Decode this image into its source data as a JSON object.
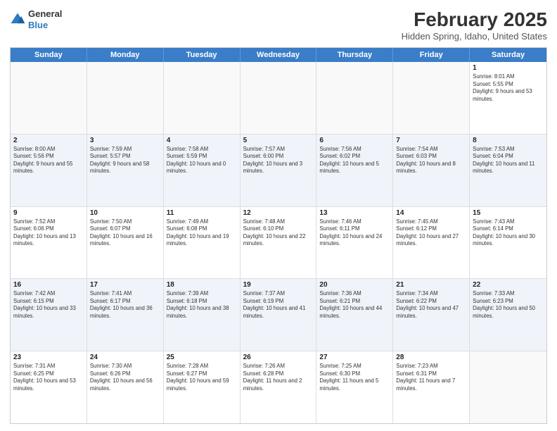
{
  "header": {
    "logo": {
      "general": "General",
      "blue": "Blue"
    },
    "title": "February 2025",
    "location": "Hidden Spring, Idaho, United States"
  },
  "calendar": {
    "days": [
      "Sunday",
      "Monday",
      "Tuesday",
      "Wednesday",
      "Thursday",
      "Friday",
      "Saturday"
    ],
    "rows": [
      [
        {
          "day": "",
          "text": ""
        },
        {
          "day": "",
          "text": ""
        },
        {
          "day": "",
          "text": ""
        },
        {
          "day": "",
          "text": ""
        },
        {
          "day": "",
          "text": ""
        },
        {
          "day": "",
          "text": ""
        },
        {
          "day": "1",
          "text": "Sunrise: 8:01 AM\nSunset: 5:55 PM\nDaylight: 9 hours and 53 minutes."
        }
      ],
      [
        {
          "day": "2",
          "text": "Sunrise: 8:00 AM\nSunset: 5:56 PM\nDaylight: 9 hours and 55 minutes."
        },
        {
          "day": "3",
          "text": "Sunrise: 7:59 AM\nSunset: 5:57 PM\nDaylight: 9 hours and 58 minutes."
        },
        {
          "day": "4",
          "text": "Sunrise: 7:58 AM\nSunset: 5:59 PM\nDaylight: 10 hours and 0 minutes."
        },
        {
          "day": "5",
          "text": "Sunrise: 7:57 AM\nSunset: 6:00 PM\nDaylight: 10 hours and 3 minutes."
        },
        {
          "day": "6",
          "text": "Sunrise: 7:56 AM\nSunset: 6:02 PM\nDaylight: 10 hours and 5 minutes."
        },
        {
          "day": "7",
          "text": "Sunrise: 7:54 AM\nSunset: 6:03 PM\nDaylight: 10 hours and 8 minutes."
        },
        {
          "day": "8",
          "text": "Sunrise: 7:53 AM\nSunset: 6:04 PM\nDaylight: 10 hours and 11 minutes."
        }
      ],
      [
        {
          "day": "9",
          "text": "Sunrise: 7:52 AM\nSunset: 6:06 PM\nDaylight: 10 hours and 13 minutes."
        },
        {
          "day": "10",
          "text": "Sunrise: 7:50 AM\nSunset: 6:07 PM\nDaylight: 10 hours and 16 minutes."
        },
        {
          "day": "11",
          "text": "Sunrise: 7:49 AM\nSunset: 6:08 PM\nDaylight: 10 hours and 19 minutes."
        },
        {
          "day": "12",
          "text": "Sunrise: 7:48 AM\nSunset: 6:10 PM\nDaylight: 10 hours and 22 minutes."
        },
        {
          "day": "13",
          "text": "Sunrise: 7:46 AM\nSunset: 6:11 PM\nDaylight: 10 hours and 24 minutes."
        },
        {
          "day": "14",
          "text": "Sunrise: 7:45 AM\nSunset: 6:12 PM\nDaylight: 10 hours and 27 minutes."
        },
        {
          "day": "15",
          "text": "Sunrise: 7:43 AM\nSunset: 6:14 PM\nDaylight: 10 hours and 30 minutes."
        }
      ],
      [
        {
          "day": "16",
          "text": "Sunrise: 7:42 AM\nSunset: 6:15 PM\nDaylight: 10 hours and 33 minutes."
        },
        {
          "day": "17",
          "text": "Sunrise: 7:41 AM\nSunset: 6:17 PM\nDaylight: 10 hours and 36 minutes."
        },
        {
          "day": "18",
          "text": "Sunrise: 7:39 AM\nSunset: 6:18 PM\nDaylight: 10 hours and 38 minutes."
        },
        {
          "day": "19",
          "text": "Sunrise: 7:37 AM\nSunset: 6:19 PM\nDaylight: 10 hours and 41 minutes."
        },
        {
          "day": "20",
          "text": "Sunrise: 7:36 AM\nSunset: 6:21 PM\nDaylight: 10 hours and 44 minutes."
        },
        {
          "day": "21",
          "text": "Sunrise: 7:34 AM\nSunset: 6:22 PM\nDaylight: 10 hours and 47 minutes."
        },
        {
          "day": "22",
          "text": "Sunrise: 7:33 AM\nSunset: 6:23 PM\nDaylight: 10 hours and 50 minutes."
        }
      ],
      [
        {
          "day": "23",
          "text": "Sunrise: 7:31 AM\nSunset: 6:25 PM\nDaylight: 10 hours and 53 minutes."
        },
        {
          "day": "24",
          "text": "Sunrise: 7:30 AM\nSunset: 6:26 PM\nDaylight: 10 hours and 56 minutes."
        },
        {
          "day": "25",
          "text": "Sunrise: 7:28 AM\nSunset: 6:27 PM\nDaylight: 10 hours and 59 minutes."
        },
        {
          "day": "26",
          "text": "Sunrise: 7:26 AM\nSunset: 6:28 PM\nDaylight: 11 hours and 2 minutes."
        },
        {
          "day": "27",
          "text": "Sunrise: 7:25 AM\nSunset: 6:30 PM\nDaylight: 11 hours and 5 minutes."
        },
        {
          "day": "28",
          "text": "Sunrise: 7:23 AM\nSunset: 6:31 PM\nDaylight: 11 hours and 7 minutes."
        },
        {
          "day": "",
          "text": ""
        }
      ]
    ]
  }
}
